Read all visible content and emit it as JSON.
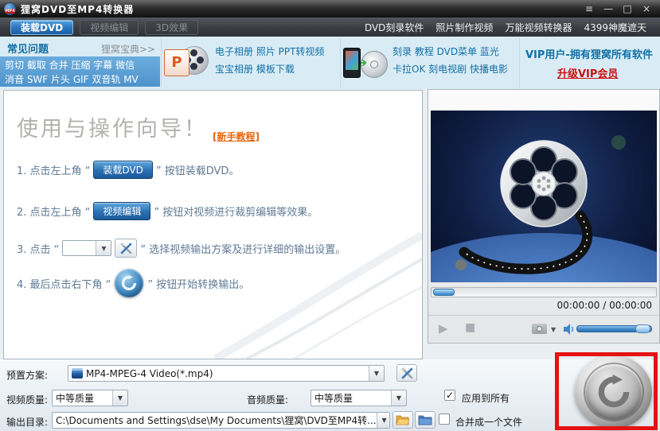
{
  "window": {
    "title": "狸窝DVD至MP4转换器",
    "controls": {
      "menu": "≡",
      "minimize": "—",
      "maximize": "□",
      "close": "×"
    }
  },
  "tab_bar": {
    "tabs": [
      {
        "label": "装载DVD",
        "active": true
      },
      {
        "label": "视频编辑",
        "active": false
      },
      {
        "label": "3D效果",
        "active": false
      }
    ],
    "links": [
      "DVD刻录软件",
      "照片制作视频",
      "万能视频转换器",
      "4399神魔遮天"
    ]
  },
  "toolbar": {
    "faq": {
      "title": "常见问题",
      "more_link": "狸窝宝典>>",
      "keywords_line1": "剪切 截取 合并 压缩 字幕 微信",
      "keywords_line2": "消音 SWF 片头 GIF 双音轨 MV"
    },
    "ppt_ad": {
      "line1": "电子相册 照片 PPT转视频",
      "line2": "宝宝相册 模板下载"
    },
    "dvd_ad": {
      "line1": "刻录 教程 DVD菜单 蓝光",
      "line2": "卡拉OK 刻电视剧 快播电影"
    },
    "vip": {
      "line1": "VIP用户-拥有狸窝所有软件",
      "upgrade_link": "升级VIP会员"
    }
  },
  "guide": {
    "title": "使用与操作向导！",
    "tutorial_link": "[新手教程]",
    "step1": {
      "prefix": "1. 点击左上角 “",
      "button_label": "装载DVD",
      "suffix": "” 按钮装载DVD。"
    },
    "step2": {
      "prefix": "2. 点击左上角 “",
      "button_label": "视频编辑",
      "suffix": "” 按钮对视频进行裁剪编辑等效果。"
    },
    "step3": {
      "prefix": "3. 点击 “",
      "suffix": "” 选择视频输出方案及进行详细的输出设置。"
    },
    "step4": {
      "prefix": "4. 最后点击右下角 “",
      "suffix": "” 按钮开始转换输出。"
    }
  },
  "player": {
    "time_display": "00:00:00 / 00:00:00",
    "play_glyph": "▶",
    "stop_glyph": "■"
  },
  "settings": {
    "preset_label": "预置方案:",
    "preset_value": "MP4-MPEG-4 Video(*.mp4)",
    "video_quality_label": "视频质量:",
    "video_quality_value": "中等质量",
    "audio_quality_label": "音频质量:",
    "audio_quality_value": "中等质量",
    "apply_all_label": "应用到所有",
    "apply_all_check": "✓",
    "output_dir_label": "输出目录:",
    "output_dir_value": "C:\\Documents and Settings\\dse\\My Documents\\狸窝\\DVD至MP4转...",
    "merge_label": "合并成一个文件"
  },
  "icons": {
    "dropdown": "▼"
  },
  "colors": {
    "accent_blue": "#2d77bd",
    "toolbar_bg": "#d9ecf5",
    "keyword_box_blue": "#5599d2",
    "text_blue": "#1270a8",
    "vip_link_red": "#cc1111",
    "tutorial_link_orange": "#e8650d",
    "highlight_red": "#e51212"
  }
}
